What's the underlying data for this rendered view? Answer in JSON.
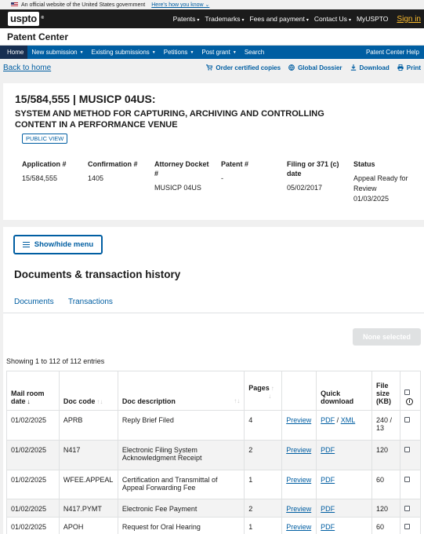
{
  "banner": {
    "text": "An official website of the United States government",
    "how_link": "Here's how you know"
  },
  "header": {
    "logo": "uspto",
    "nav": [
      {
        "label": "Patents",
        "caret": true
      },
      {
        "label": "Trademarks",
        "caret": true
      },
      {
        "label": "Fees and payment",
        "caret": true
      },
      {
        "label": "Contact Us",
        "caret": true
      },
      {
        "label": "MyUSPTO",
        "caret": false
      }
    ],
    "signin": "Sign in"
  },
  "app_title": "Patent Center",
  "main_nav": {
    "items": [
      {
        "label": "Home",
        "caret": false
      },
      {
        "label": "New submission",
        "caret": true
      },
      {
        "label": "Existing submissions",
        "caret": true
      },
      {
        "label": "Petitions",
        "caret": true
      },
      {
        "label": "Post grant",
        "caret": true
      },
      {
        "label": "Search",
        "caret": false
      }
    ],
    "help": "Patent Center Help"
  },
  "actions": {
    "back": "Back to home",
    "order": "Order certified copies",
    "dossier": "Global Dossier",
    "download": "Download",
    "print": "Print"
  },
  "case": {
    "title": "15/584,555 | MUSICP 04US:",
    "subtitle": "SYSTEM AND METHOD FOR CAPTURING, ARCHIVING AND CONTROLLING CONTENT IN A PERFORMANCE VENUE",
    "badge": "PUBLIC VIEW",
    "fields": {
      "application": {
        "label": "Application #",
        "value": "15/584,555"
      },
      "confirmation": {
        "label": "Confirmation #",
        "value": "1405"
      },
      "docket": {
        "label": "Attorney Docket #",
        "value": "MUSICP 04US"
      },
      "patent": {
        "label": "Patent #",
        "value": "-"
      },
      "filing": {
        "label": "Filing or 371 (c) date",
        "value": "05/02/2017"
      },
      "status": {
        "label": "Status",
        "value": "Appeal Ready for Review 01/03/2025"
      }
    }
  },
  "docs": {
    "showhide": "Show/hide menu",
    "heading": "Documents & transaction history",
    "tabs": {
      "documents": "Documents",
      "transactions": "Transactions"
    },
    "none_selected": "None selected",
    "showing": "Showing 1 to 112 of 112 entries",
    "columns": {
      "mail": "Mail room date",
      "code": "Doc code",
      "desc": "Doc description",
      "pages": "Pages",
      "quick": "Quick download",
      "size": "File size (KB)"
    },
    "rows": [
      {
        "date": "01/02/2025",
        "code": "APRB",
        "desc": "Reply Brief Filed",
        "pages": "4",
        "preview": "Preview",
        "pdf": "PDF",
        "xml": "XML",
        "size": "240 / 13"
      },
      {
        "date": "01/02/2025",
        "code": "N417",
        "desc": "Electronic Filing System Acknowledgment Receipt",
        "pages": "2",
        "preview": "Preview",
        "pdf": "PDF",
        "xml": "",
        "size": "120"
      },
      {
        "date": "01/02/2025",
        "code": "WFEE.APPEAL",
        "desc": "Certification and Transmittal of Appeal Forwarding Fee",
        "pages": "1",
        "preview": "Preview",
        "pdf": "PDF",
        "xml": "",
        "size": "60"
      },
      {
        "date": "01/02/2025",
        "code": "N417.PYMT",
        "desc": "Electronic Fee Payment",
        "pages": "2",
        "preview": "Preview",
        "pdf": "PDF",
        "xml": "",
        "size": "120"
      },
      {
        "date": "01/02/2025",
        "code": "APOH",
        "desc": "Request for Oral Hearing",
        "pages": "1",
        "preview": "Preview",
        "pdf": "PDF",
        "xml": "",
        "size": "60"
      }
    ]
  },
  "colors": {
    "primary": "#005ea2",
    "dark_nav": "#162e51",
    "header_bg": "#1b1b1b",
    "signin": "#ffbe2e"
  }
}
